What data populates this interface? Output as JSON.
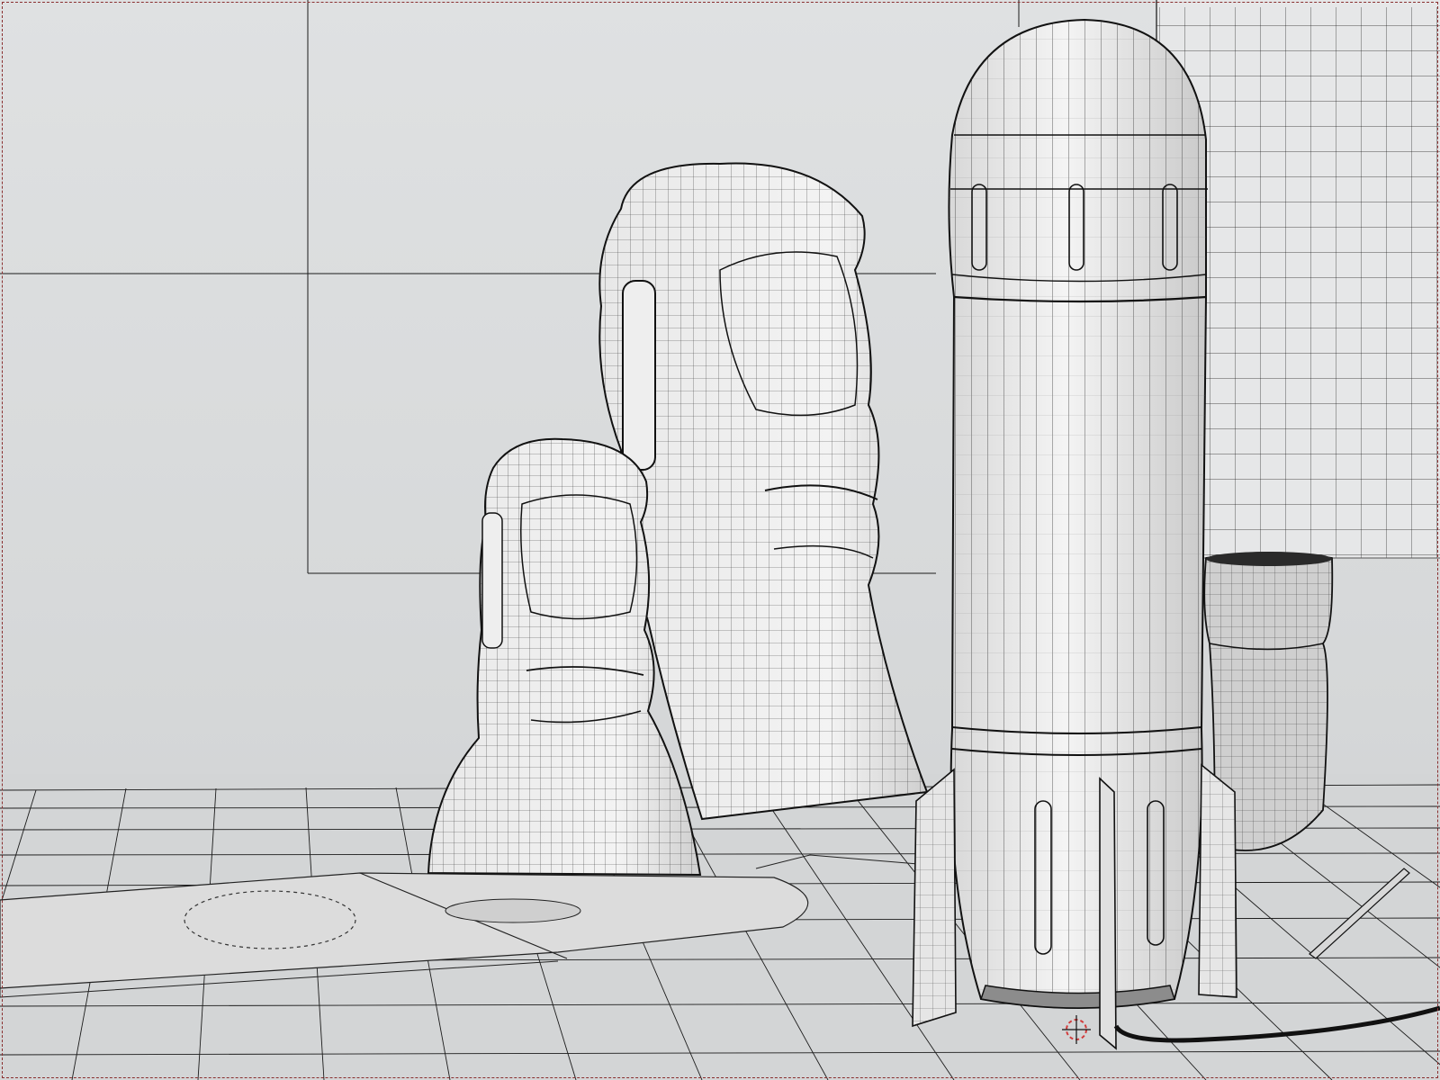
{
  "viewport": {
    "name": "3D Viewport",
    "shading": "solid-wireframe",
    "objects": [
      {
        "name": "small-moai-statue"
      },
      {
        "name": "large-moai-statue"
      },
      {
        "name": "rocket"
      },
      {
        "name": "cup"
      },
      {
        "name": "floor"
      },
      {
        "name": "back-wall"
      },
      {
        "name": "paper-sheet"
      }
    ],
    "cursor_icon": "3d-cursor-icon",
    "colors": {
      "background": "#d9dbdc",
      "wire": "#111111",
      "cursor_ring": "#d23b3b"
    }
  }
}
